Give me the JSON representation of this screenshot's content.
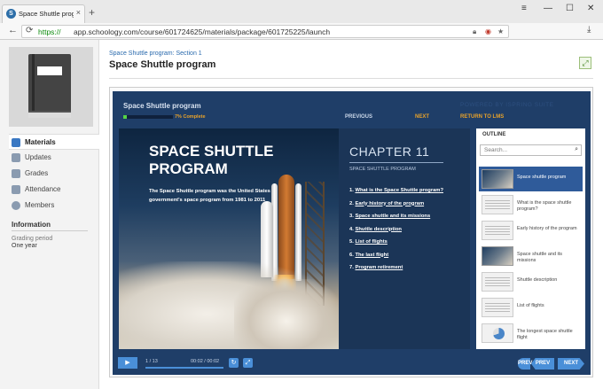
{
  "browser": {
    "tab_title": "Space Shuttle progra",
    "tab_close": "×",
    "new_tab": "+",
    "win_min": "—",
    "win_max": "☐",
    "win_close": "✕",
    "win_menu": "≡",
    "url_scheme": "https://",
    "url_rest": "app.schoology.com/course/601724625/materials/package/601725225/launch"
  },
  "sidebar": {
    "items": [
      {
        "label": "Materials"
      },
      {
        "label": "Updates"
      },
      {
        "label": "Grades"
      },
      {
        "label": "Attendance"
      },
      {
        "label": "Members"
      }
    ],
    "info_heading": "Information",
    "grading_period_label": "Grading period",
    "grading_period_value": "One year"
  },
  "header": {
    "breadcrumb": "Space Shuttle program: Section 1",
    "title": "Space Shuttle program"
  },
  "player": {
    "title": "Space Shuttle program",
    "powered_by": "POWERED BY ISPRING SUITE",
    "progress_fraction": 0.07,
    "progress_text": "7% Complete",
    "prev_label": "PREVIOUS",
    "next_label": "NEXT",
    "return_label": "RETURN TO LMS",
    "slide": {
      "title": "SPACE SHUTTLE PROGRAM",
      "subtitle": "The Space Shuttle program was the United States government's space program from 1981 to 2011",
      "chapter_title": "CHAPTER 11",
      "chapter_subtitle": "SPACE SHUTTLE PROGRAM",
      "chapters": [
        {
          "num": "1.",
          "text": "What is the Space Shuttle program?"
        },
        {
          "num": "2.",
          "text": "Early history of the program"
        },
        {
          "num": "3.",
          "text": "Space shuttle and its missions"
        },
        {
          "num": "4.",
          "text": "Shuttle description"
        },
        {
          "num": "5.",
          "text": "List of flights"
        },
        {
          "num": "6.",
          "text": "The last flight"
        },
        {
          "num": "7.",
          "text": "Program retirement"
        }
      ]
    },
    "outline": {
      "heading": "OUTLINE",
      "search_placeholder": "Search...",
      "items": [
        {
          "label": "Space shuttle program"
        },
        {
          "label": "What is the space shuttle program?"
        },
        {
          "label": "Early history of the program"
        },
        {
          "label": "Space shuttle and its missions"
        },
        {
          "label": "Shuttle description"
        },
        {
          "label": "List of flights"
        },
        {
          "label": "The longest space shuttle flight"
        }
      ]
    },
    "controls": {
      "play_icon": "▶",
      "slide_count": "1 / 13",
      "time": "00:02 / 00:02",
      "replay_icon": "↻",
      "fullscreen_icon": "⤢",
      "prev_short": "PREV",
      "prev_label": "PREV",
      "next_label": "NEXT"
    }
  }
}
